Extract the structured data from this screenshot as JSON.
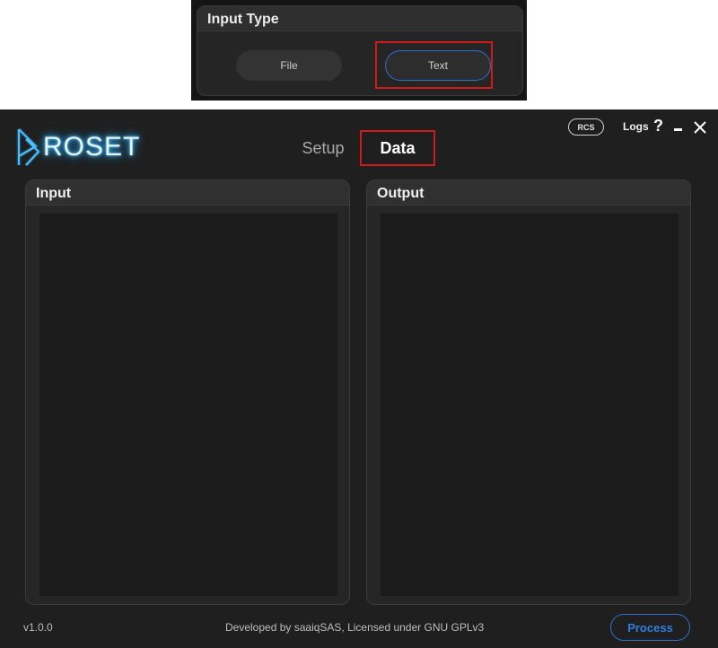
{
  "inset": {
    "title": "Input Type",
    "options": [
      {
        "label": "File",
        "selected": false
      },
      {
        "label": "Text",
        "selected": true
      }
    ]
  },
  "app": {
    "logo_text": "ROSET",
    "tabs": [
      {
        "label": "Setup",
        "active": false
      },
      {
        "label": "Data",
        "active": true
      }
    ],
    "controls": {
      "rcs_label": "RCS",
      "logs_label": "Logs",
      "help_label": "?"
    },
    "panels": {
      "input": {
        "title": "Input",
        "content": ""
      },
      "output": {
        "title": "Output",
        "content": ""
      }
    },
    "footer": {
      "version": "v1.0.0",
      "developer": "Developed by saaiqSAS, Licensed under GNU GPLv3",
      "process_label": "Process"
    }
  },
  "colors": {
    "accent": "#2e6fd1",
    "highlight": "#d11b1b",
    "logo_glow": "#1f9be8",
    "background": "#1f1f1f",
    "panel": "#262626"
  },
  "icons": [
    "minimize-icon",
    "close-icon",
    "roset-logo-icon"
  ]
}
